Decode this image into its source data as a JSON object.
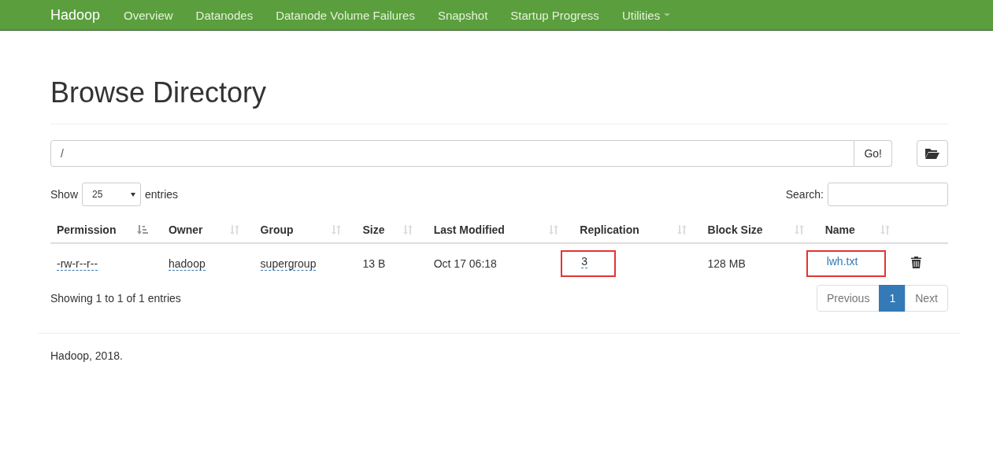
{
  "navbar": {
    "brand": "Hadoop",
    "items": [
      {
        "label": "Overview",
        "dropdown": false
      },
      {
        "label": "Datanodes",
        "dropdown": false
      },
      {
        "label": "Datanode Volume Failures",
        "dropdown": false
      },
      {
        "label": "Snapshot",
        "dropdown": false
      },
      {
        "label": "Startup Progress",
        "dropdown": false
      },
      {
        "label": "Utilities",
        "dropdown": true
      }
    ]
  },
  "page": {
    "title": "Browse Directory"
  },
  "path_bar": {
    "value": "/",
    "go_button": "Go!"
  },
  "length_control": {
    "label_before": "Show",
    "value": "25",
    "label_after": "entries"
  },
  "search": {
    "label": "Search:"
  },
  "table": {
    "columns": [
      {
        "label": "Permission",
        "sorted": true
      },
      {
        "label": "Owner",
        "sorted": false
      },
      {
        "label": "Group",
        "sorted": false
      },
      {
        "label": "Size",
        "sorted": false
      },
      {
        "label": "Last Modified",
        "sorted": false
      },
      {
        "label": "Replication",
        "sorted": false
      },
      {
        "label": "Block Size",
        "sorted": false
      },
      {
        "label": "Name",
        "sorted": false
      }
    ],
    "rows": [
      {
        "cells": [
          {
            "text": "-rw-r--r--",
            "kind": "dotted",
            "highlighted": false
          },
          {
            "text": "hadoop",
            "kind": "dotted",
            "highlighted": false
          },
          {
            "text": "supergroup",
            "kind": "dotted",
            "highlighted": false
          },
          {
            "text": "13 B",
            "kind": "plain",
            "highlighted": false
          },
          {
            "text": "Oct 17 06:18",
            "kind": "plain",
            "highlighted": false
          },
          {
            "text": "3",
            "kind": "dotted",
            "highlighted": true
          },
          {
            "text": "128 MB",
            "kind": "plain",
            "highlighted": false
          },
          {
            "text": "lwh.txt",
            "kind": "link",
            "highlighted": true
          }
        ]
      }
    ]
  },
  "info": "Showing 1 to 1 of 1 entries",
  "pagination": [
    {
      "label": "Previous",
      "selected": false,
      "disabled": true
    },
    {
      "label": "1",
      "selected": true,
      "disabled": false
    },
    {
      "label": "Next",
      "selected": false,
      "disabled": true
    }
  ],
  "footer": "Hadoop, 2018."
}
